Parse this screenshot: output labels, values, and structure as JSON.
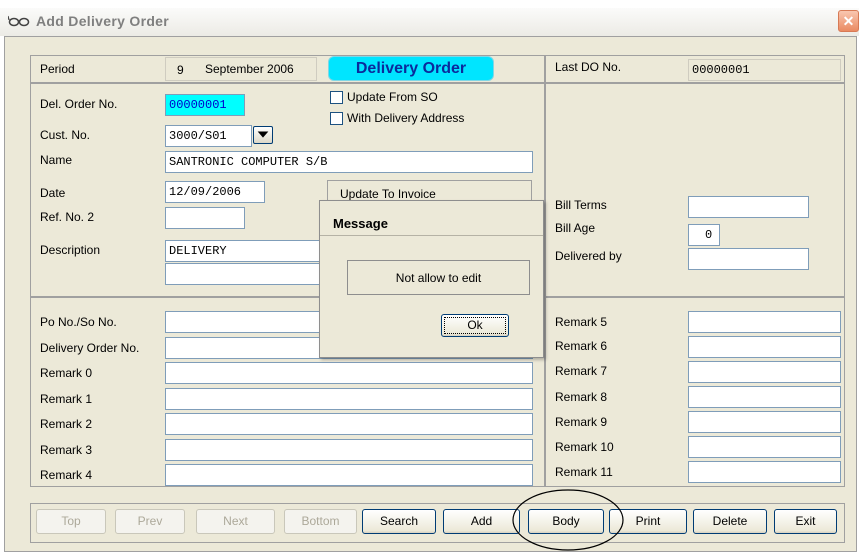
{
  "window": {
    "title": "Add Delivery Order",
    "close_glyph": "✕"
  },
  "header": {
    "period_label": "Period",
    "period_number": "9",
    "period_text": "September 2006",
    "banner": "Delivery Order",
    "last_do_label": "Last DO No.",
    "last_do_value": "00000001"
  },
  "form": {
    "del_order_label": "Del. Order No.",
    "del_order_value": "00000001",
    "update_from_so_label": "Update From SO",
    "with_delivery_address_label": "With Delivery Address",
    "cust_no_label": "Cust. No.",
    "cust_no_value": "3000/S01",
    "name_label": "Name",
    "name_value": "SANTRONIC COMPUTER S/B",
    "date_label": "Date",
    "date_value": "12/09/2006",
    "update_to_invoice_label": "Update To Invoice",
    "ref_no2_label": "Ref. No. 2",
    "ref_no2_value": "",
    "description_label": "Description",
    "description_value": "DELIVERY",
    "description2_value": ""
  },
  "right_panel": {
    "bill_terms_label": "Bill Terms",
    "bill_terms_value": "",
    "bill_age_label": "Bill Age",
    "bill_age_value": "0",
    "delivered_by_label": "Delivered by",
    "delivered_by_value": ""
  },
  "remarks_left": [
    {
      "label": "Po No./So No.",
      "value": ""
    },
    {
      "label": "Delivery Order No.",
      "value": ""
    },
    {
      "label": "Remark 0",
      "value": ""
    },
    {
      "label": "Remark 1",
      "value": ""
    },
    {
      "label": "Remark 2",
      "value": ""
    },
    {
      "label": "Remark 3",
      "value": ""
    },
    {
      "label": "Remark 4",
      "value": ""
    }
  ],
  "remarks_right": [
    {
      "label": "Remark 5",
      "value": ""
    },
    {
      "label": "Remark 6",
      "value": ""
    },
    {
      "label": "Remark 7",
      "value": ""
    },
    {
      "label": "Remark 8",
      "value": ""
    },
    {
      "label": "Remark 9",
      "value": ""
    },
    {
      "label": "Remark 10",
      "value": ""
    },
    {
      "label": "Remark 11",
      "value": ""
    }
  ],
  "buttons": {
    "top": "Top",
    "prev": "Prev",
    "next": "Next",
    "bottom": "Bottom",
    "search": "Search",
    "add": "Add",
    "body": "Body",
    "print": "Print",
    "delete": "Delete",
    "exit": "Exit"
  },
  "dialog": {
    "title": "Message",
    "message": "Not allow to edit",
    "ok_label": "Ok"
  },
  "colors": {
    "banner_bg": "#00e5ff",
    "highlight_field": "#00ffff",
    "form_bg": "#ece9d8"
  }
}
